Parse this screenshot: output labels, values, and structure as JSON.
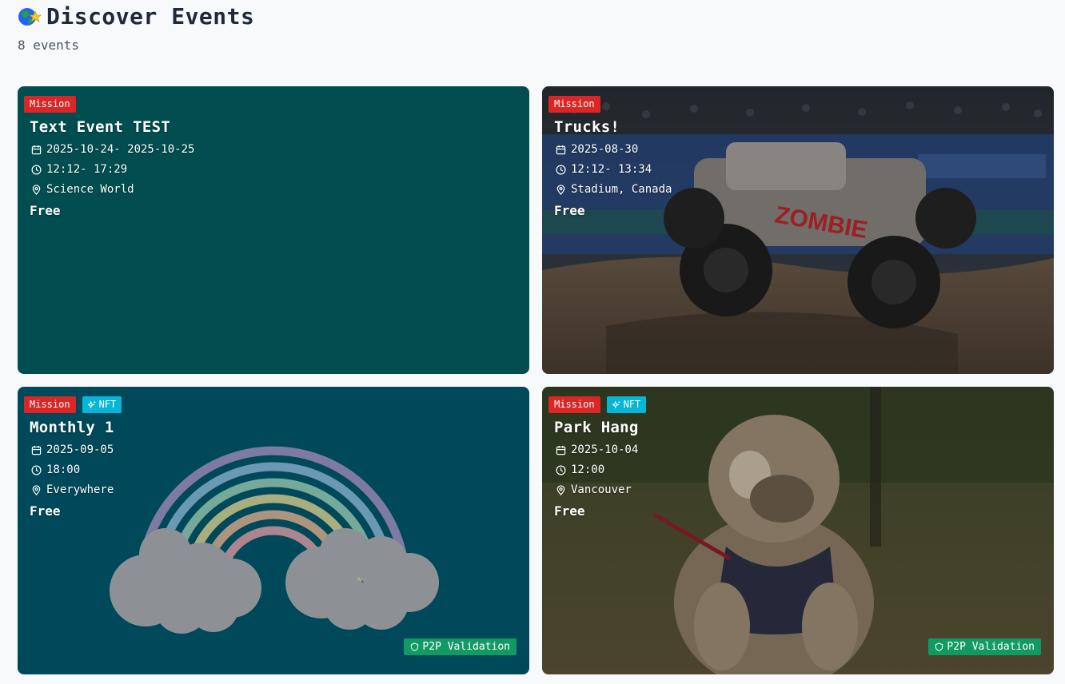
{
  "header": {
    "title": "Discover Events",
    "count": "8 events"
  },
  "events": [
    {
      "badges": [
        "Mission"
      ],
      "title": "Text Event TEST",
      "date": "2025-10-24- 2025-10-25",
      "time": "12:12- 17:29",
      "location": "Science World",
      "price": "Free",
      "bg_color": "#024d4f"
    },
    {
      "badges": [
        "Mission"
      ],
      "title": "Trucks!",
      "date": "2025-08-30",
      "time": "12:12- 13:34",
      "location": "Stadium, Canada",
      "price": "Free",
      "image": "monster truck in stadium"
    },
    {
      "badges": [
        "Mission",
        "NFT"
      ],
      "title": "Monthly 1",
      "date": "2025-09-05",
      "time": "18:00",
      "location": "Everywhere",
      "price": "Free",
      "bg_color": "#00495a",
      "image": "rainbow with clouds",
      "validation": "P2P Validation"
    },
    {
      "badges": [
        "Mission",
        "NFT"
      ],
      "title": "Park Hang",
      "date": "2025-10-04",
      "time": "12:00",
      "location": "Vancouver",
      "price": "Free",
      "image": "bulldog in park",
      "validation": "P2P Validation"
    }
  ],
  "colors": {
    "mission_badge": "#dc2626",
    "nft_badge": "#06b6d4",
    "p2p_badge": "#129a63"
  }
}
